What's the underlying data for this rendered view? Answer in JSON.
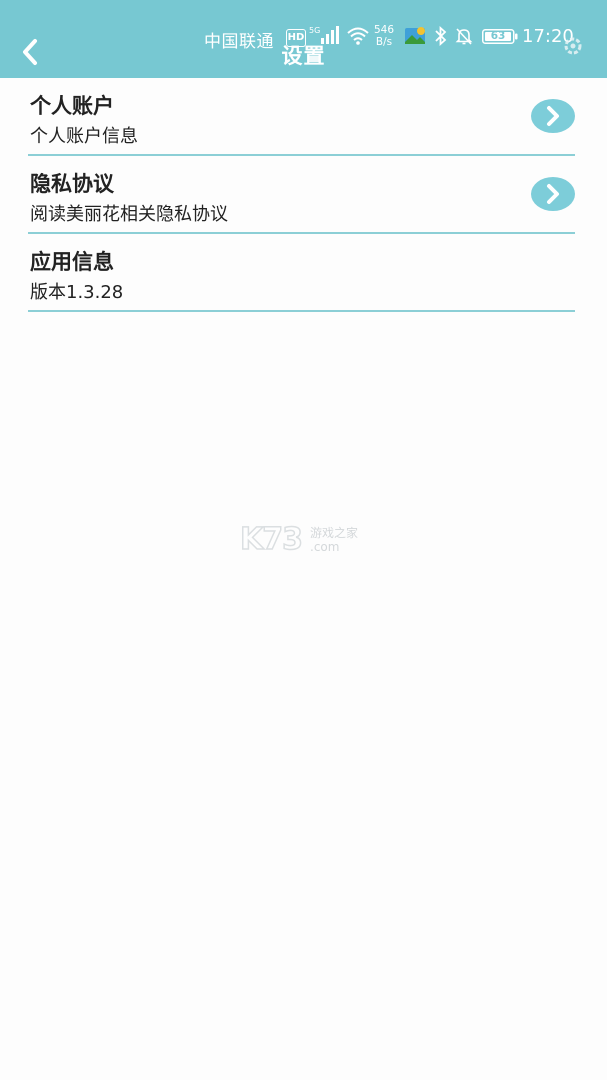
{
  "status_bar": {
    "carrier": "中国联通",
    "hd": "HD",
    "network": "5G",
    "net_speed_value": "546",
    "net_speed_unit": "B/s",
    "battery": "63",
    "time": "17:20"
  },
  "header": {
    "title": "设置",
    "background_color": "#77c8d2"
  },
  "settings": {
    "items": [
      {
        "title": "个人账户",
        "desc": "个人账户信息"
      },
      {
        "title": "隐私协议",
        "desc": "阅读美丽花相关隐私协议"
      },
      {
        "title": "应用信息",
        "desc": "版本1.3.28"
      }
    ]
  },
  "watermark": {
    "brand": "K73",
    "site": "游戏之家",
    "domain": ".com"
  },
  "icons": {
    "back": "chevron-left-icon",
    "item_action": "chevron-right-icon"
  }
}
